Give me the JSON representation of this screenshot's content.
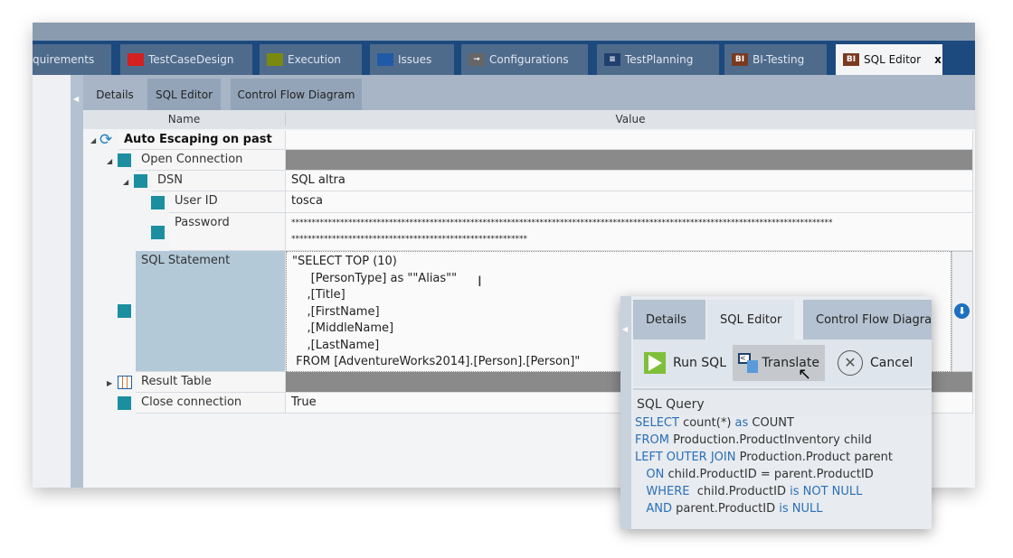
{
  "main_tabs": [
    {
      "label": "quirements",
      "icon": "none"
    },
    {
      "label": "TestCaseDesign",
      "icon": "folder-red-icon",
      "color": "#d42020"
    },
    {
      "label": "Execution",
      "icon": "folder-olive-icon",
      "color": "#7a8a10"
    },
    {
      "label": "Issues",
      "icon": "folder-blue-icon",
      "color": "#1f5aa8"
    },
    {
      "label": "Configurations",
      "icon": "key-icon",
      "color": "#666"
    },
    {
      "label": "TestPlanning",
      "icon": "list-icon",
      "color": "#1f3f6e"
    },
    {
      "label": "BI-Testing",
      "icon": "bi-icon",
      "color": "#7a3a20"
    },
    {
      "label": "SQL Editor",
      "icon": "bi-icon",
      "color": "#7a3a20",
      "active": true,
      "close": "x"
    }
  ],
  "sub_tabs": [
    "Details",
    "SQL Editor",
    "Control Flow Diagram"
  ],
  "table": {
    "name_header": "Name",
    "value_header": "Value"
  },
  "rows": {
    "root": "Auto Escaping on past",
    "open_connection": "Open Connection",
    "dsn": {
      "name": "DSN",
      "value": "SQL altra"
    },
    "user_id": {
      "name": "User ID",
      "value": "tosca"
    },
    "password": {
      "name": "Password",
      "value_line1": "*************************************************************************************************************************************",
      "value_line2": "**********************************************************"
    },
    "sql_statement": {
      "name": "SQL Statement",
      "lines": [
        "\"SELECT TOP (10)",
        "     [PersonType] as \"\"Alias\"\"",
        "    ,[Title]",
        "    ,[FirstName]",
        "    ,[MiddleName]",
        "    ,[LastName]",
        " FROM [AdventureWorks2014].[Person].[Person]\""
      ]
    },
    "result_table": "Result Table",
    "close_connection": {
      "name": "Close connection",
      "value": "True"
    }
  },
  "popup": {
    "tabs": [
      "Details",
      "SQL Editor",
      "Control Flow Diagram"
    ],
    "buttons": {
      "run": "Run SQL",
      "translate": "Translate",
      "cancel": "Cancel"
    },
    "query_label": "SQL Query",
    "query": [
      [
        [
          "kw",
          "SELECT"
        ],
        [
          "t",
          " count(*) "
        ],
        [
          "kw",
          "as"
        ],
        [
          "t",
          " COUNT"
        ]
      ],
      [
        [
          "kw",
          "FROM"
        ],
        [
          "t",
          " Production.ProductInventory child"
        ]
      ],
      [
        [
          "kw",
          "LEFT OUTER JOIN"
        ],
        [
          "t",
          " Production.Product parent"
        ]
      ],
      [
        [
          "t",
          "   "
        ],
        [
          "kw",
          "ON"
        ],
        [
          "t",
          " child.ProductID = parent.ProductID"
        ]
      ],
      [
        [
          "t",
          "   "
        ],
        [
          "kw",
          "WHERE"
        ],
        [
          "t",
          "  child.ProductID "
        ],
        [
          "kw",
          "is NOT NULL"
        ]
      ],
      [
        [
          "t",
          "   "
        ],
        [
          "kw",
          "AND"
        ],
        [
          "t",
          " parent.ProductID "
        ],
        [
          "kw",
          "is NULL"
        ]
      ]
    ]
  }
}
